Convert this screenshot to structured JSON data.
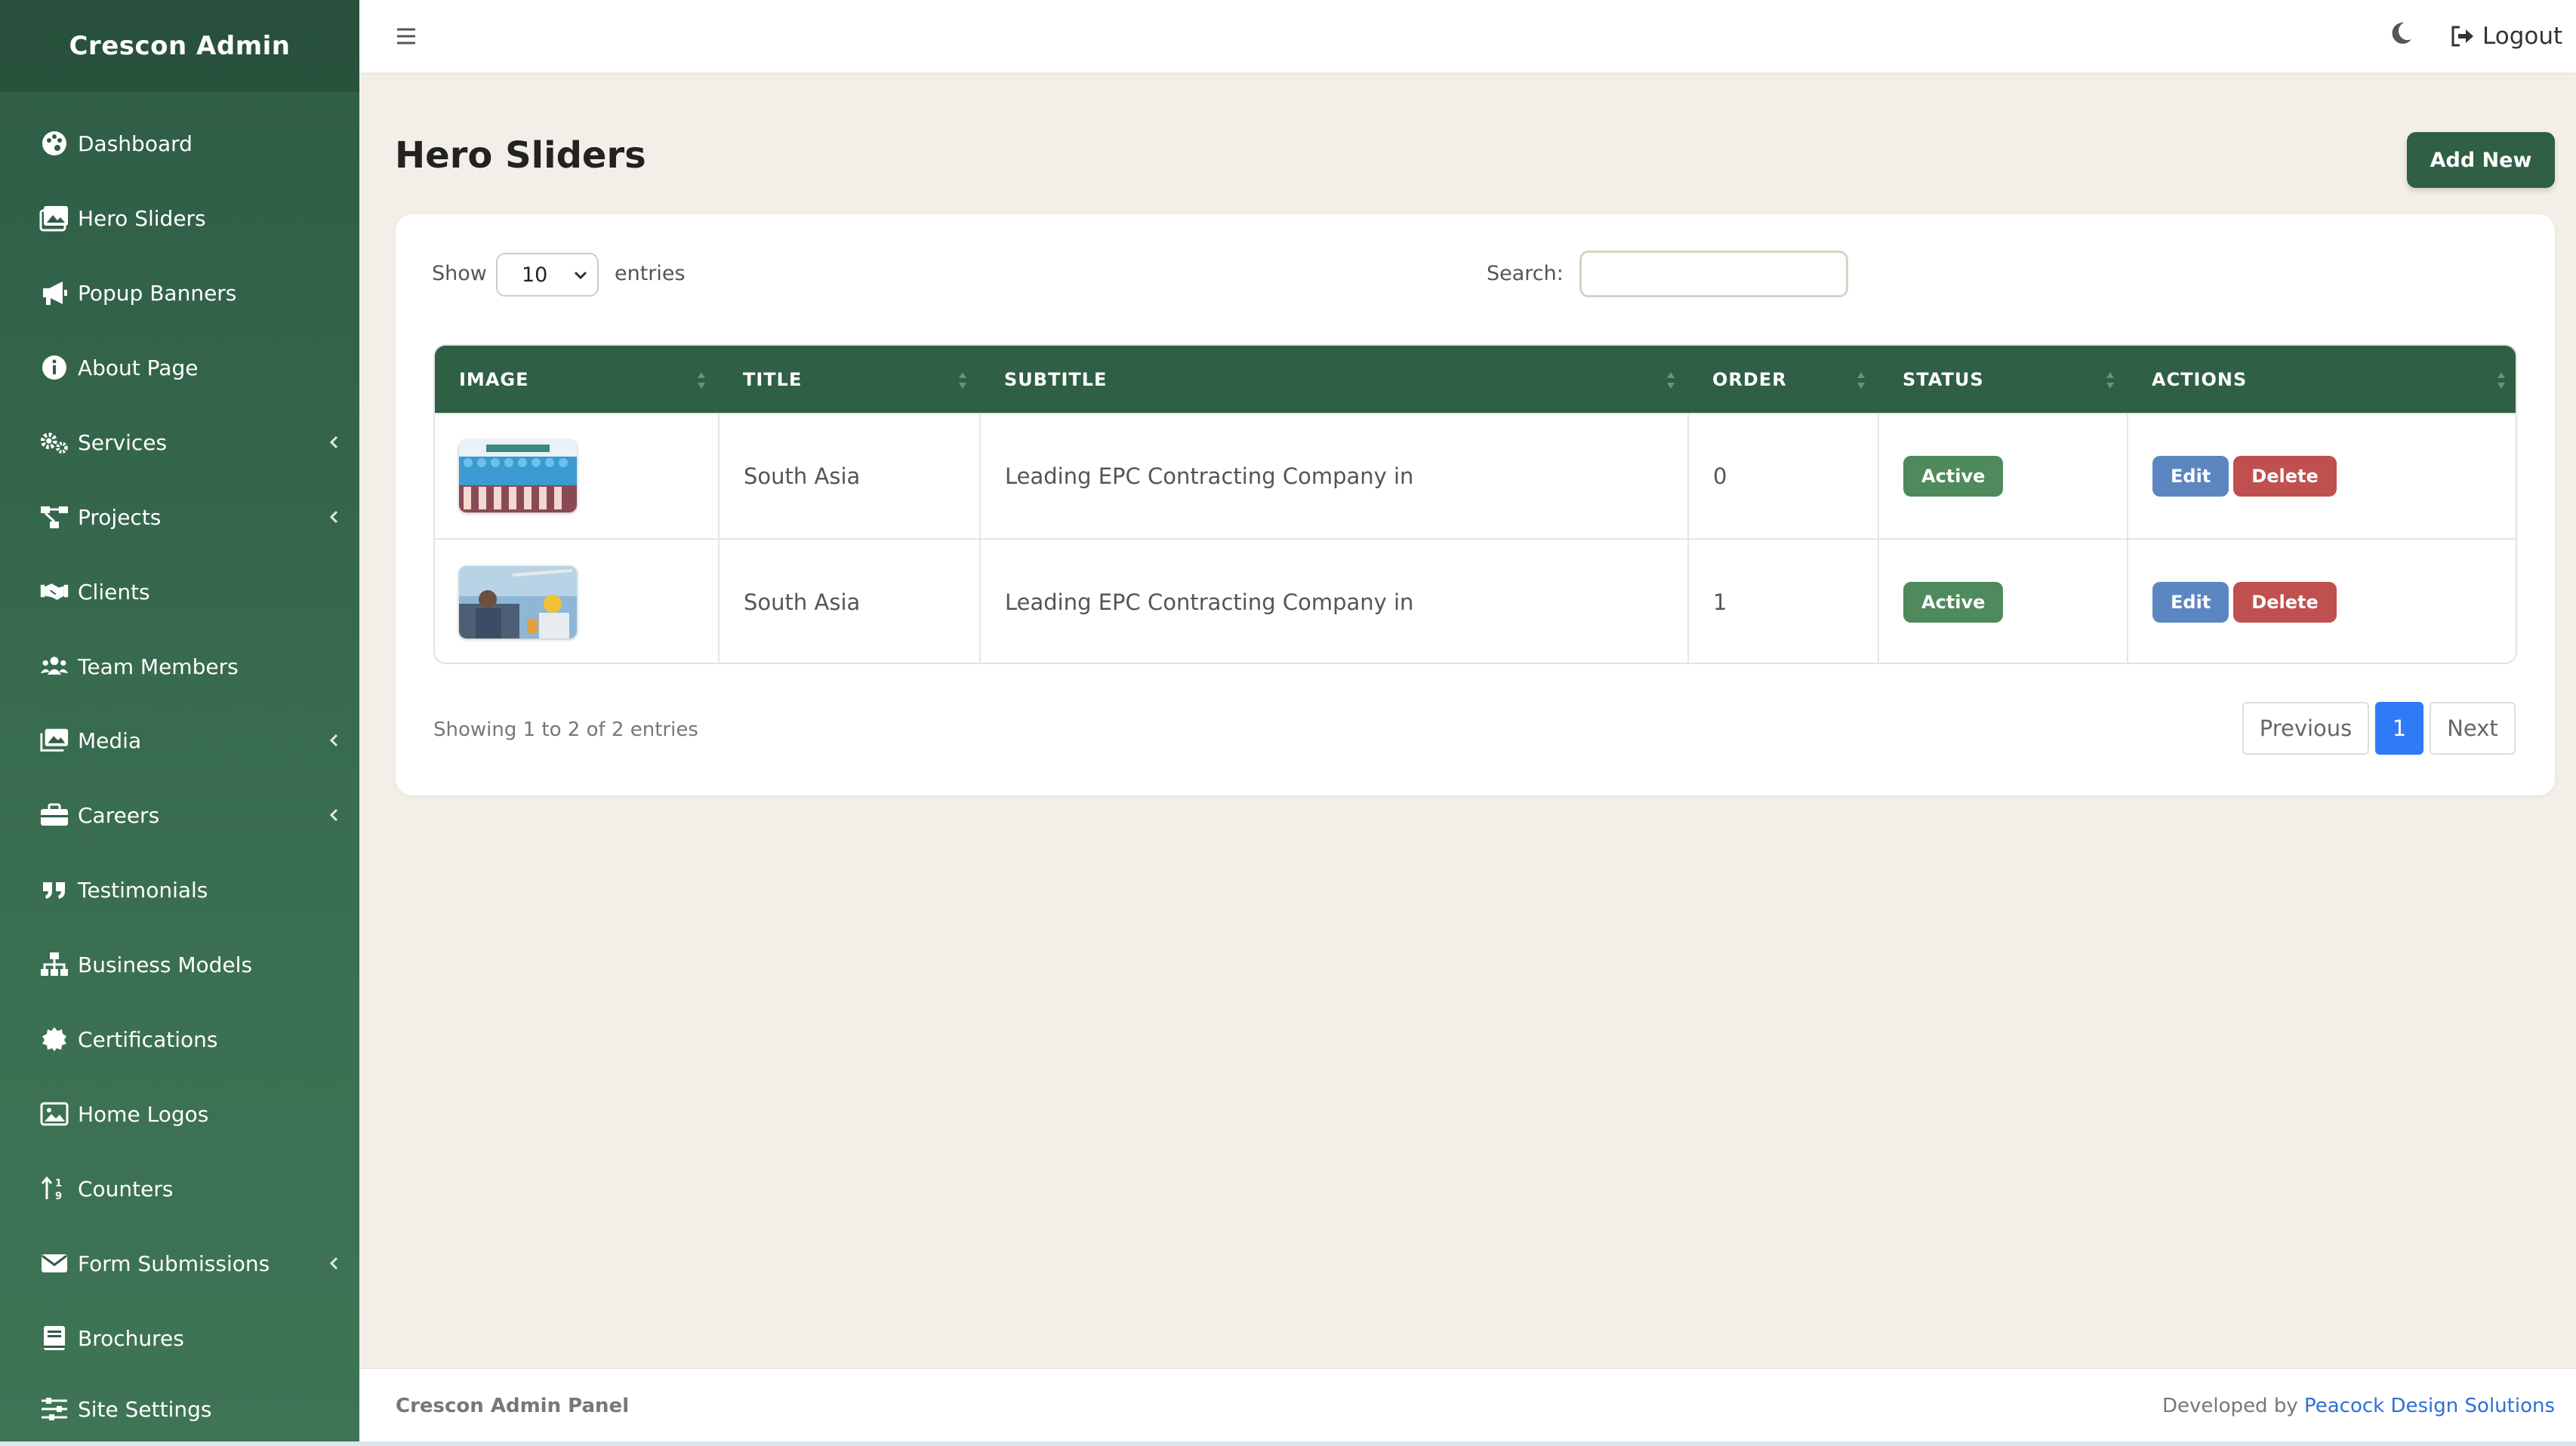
{
  "app": {
    "brand": "Crescon Admin"
  },
  "sidebar": {
    "items": [
      {
        "label": "Dashboard",
        "icon": "palette-icon",
        "submenu": false
      },
      {
        "label": "Hero Sliders",
        "icon": "images-icon",
        "submenu": false
      },
      {
        "label": "Popup Banners",
        "icon": "bullhorn-icon",
        "submenu": false
      },
      {
        "label": "About Page",
        "icon": "info-icon",
        "submenu": false
      },
      {
        "label": "Services",
        "icon": "cogs-icon",
        "submenu": true
      },
      {
        "label": "Projects",
        "icon": "project-diagram-icon",
        "submenu": true
      },
      {
        "label": "Clients",
        "icon": "handshake-icon",
        "submenu": false
      },
      {
        "label": "Team Members",
        "icon": "users-icon",
        "submenu": false
      },
      {
        "label": "Media",
        "icon": "photo-gallery-icon",
        "submenu": true
      },
      {
        "label": "Careers",
        "icon": "briefcase-icon",
        "submenu": true
      },
      {
        "label": "Testimonials",
        "icon": "quote-icon",
        "submenu": false
      },
      {
        "label": "Business Models",
        "icon": "sitemap-icon",
        "submenu": false
      },
      {
        "label": "Certifications",
        "icon": "certificate-icon",
        "submenu": false
      },
      {
        "label": "Home Logos",
        "icon": "image-icon",
        "submenu": false
      },
      {
        "label": "Counters",
        "icon": "sort-numeric-icon",
        "submenu": false
      },
      {
        "label": "Form Submissions",
        "icon": "envelope-icon",
        "submenu": true
      },
      {
        "label": "Brochures",
        "icon": "book-icon",
        "submenu": false
      },
      {
        "label": "Site Settings",
        "icon": "sliders-icon",
        "submenu": false
      }
    ]
  },
  "topbar": {
    "logout_label": "Logout"
  },
  "main": {
    "title": "Hero Sliders",
    "add_button": "Add New",
    "show_label": "Show",
    "entries_label": "entries",
    "page_size": "10",
    "search_label": "Search:",
    "search_value": "",
    "columns": [
      "IMAGE",
      "TITLE",
      "SUBTITLE",
      "ORDER",
      "STATUS",
      "ACTIONS"
    ],
    "rows": [
      {
        "title": "South Asia",
        "subtitle": "Leading EPC Contracting Company in",
        "order": "0",
        "status": "Active",
        "edit": "Edit",
        "delete": "Delete"
      },
      {
        "title": "South Asia",
        "subtitle": "Leading EPC Contracting Company in",
        "order": "1",
        "status": "Active",
        "edit": "Edit",
        "delete": "Delete"
      }
    ],
    "info": "Showing 1 to 2 of 2 entries",
    "pagination": {
      "previous": "Previous",
      "current": "1",
      "next": "Next"
    }
  },
  "footer": {
    "left": "Crescon Admin Panel",
    "developed_by": "Developed by",
    "developer": "Peacock Design Solutions"
  },
  "colors": {
    "sidebar": "#2e5c45",
    "primary": "#2f5f45",
    "active_badge": "#4f8a5c",
    "edit": "#5b86c2",
    "delete": "#c0504f",
    "pagination_active": "#2f7bf5"
  }
}
